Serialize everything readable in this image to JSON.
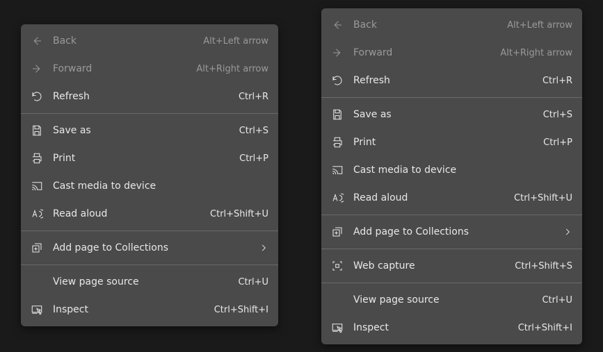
{
  "menus": {
    "left": {
      "items": [
        {
          "label": "Back",
          "shortcut": "Alt+Left arrow"
        },
        {
          "label": "Forward",
          "shortcut": "Alt+Right arrow"
        },
        {
          "label": "Refresh",
          "shortcut": "Ctrl+R"
        },
        {
          "label": "Save as",
          "shortcut": "Ctrl+S"
        },
        {
          "label": "Print",
          "shortcut": "Ctrl+P"
        },
        {
          "label": "Cast media to device",
          "shortcut": ""
        },
        {
          "label": "Read aloud",
          "shortcut": "Ctrl+Shift+U"
        },
        {
          "label": "Add page to Collections",
          "shortcut": ""
        },
        {
          "label": "View page source",
          "shortcut": "Ctrl+U"
        },
        {
          "label": "Inspect",
          "shortcut": "Ctrl+Shift+I"
        }
      ]
    },
    "right": {
      "items": [
        {
          "label": "Back",
          "shortcut": "Alt+Left arrow"
        },
        {
          "label": "Forward",
          "shortcut": "Alt+Right arrow"
        },
        {
          "label": "Refresh",
          "shortcut": "Ctrl+R"
        },
        {
          "label": "Save as",
          "shortcut": "Ctrl+S"
        },
        {
          "label": "Print",
          "shortcut": "Ctrl+P"
        },
        {
          "label": "Cast media to device",
          "shortcut": ""
        },
        {
          "label": "Read aloud",
          "shortcut": "Ctrl+Shift+U"
        },
        {
          "label": "Add page to Collections",
          "shortcut": ""
        },
        {
          "label": "Web capture",
          "shortcut": "Ctrl+Shift+S"
        },
        {
          "label": "View page source",
          "shortcut": "Ctrl+U"
        },
        {
          "label": "Inspect",
          "shortcut": "Ctrl+Shift+I"
        }
      ]
    }
  }
}
